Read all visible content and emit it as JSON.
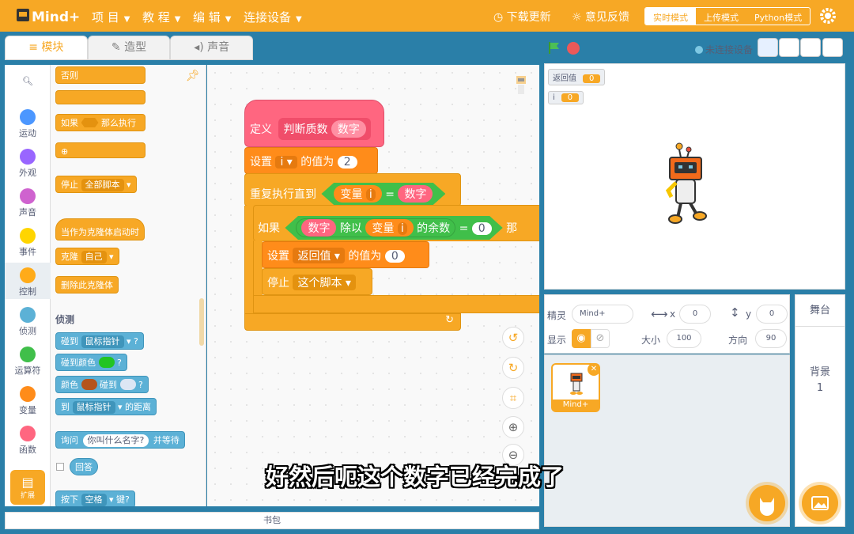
{
  "menu": {
    "items": [
      "项 目",
      "教 程",
      "编 辑",
      "连接设备"
    ],
    "download": "下载更新",
    "feedback": "意见反馈",
    "modes": [
      "实时模式",
      "上传模式",
      "Python模式"
    ]
  },
  "tabs": [
    "模块",
    "造型",
    "声音"
  ],
  "stage": {
    "status": "未连接设备",
    "monitors": [
      {
        "label": "返回值",
        "value": "0"
      },
      {
        "label": "i",
        "value": "0"
      }
    ]
  },
  "categories": [
    {
      "label": "运动",
      "color": "#4c97ff"
    },
    {
      "label": "外观",
      "color": "#9966ff"
    },
    {
      "label": "声音",
      "color": "#cf63cf"
    },
    {
      "label": "事件",
      "color": "#ffd500"
    },
    {
      "label": "控制",
      "color": "#ffab19"
    },
    {
      "label": "侦测",
      "color": "#5cb1d6"
    },
    {
      "label": "运算符",
      "color": "#40bf4a"
    },
    {
      "label": "变量",
      "color": "#ff8c1a"
    },
    {
      "label": "函数",
      "color": "#ff6680"
    }
  ],
  "extension_label": "扩展",
  "palette": {
    "else": "否则",
    "if_label": "如果",
    "then": "那么执行",
    "stop": "停止",
    "stop_opt": "全部脚本",
    "clone_start": "当作为克隆体启动时",
    "clone": "克隆",
    "clone_opt": "自己",
    "delete_clone": "删除此克隆体",
    "sensing_title": "侦测",
    "touch": "碰到",
    "mouse": "鼠标指针",
    "q": "?",
    "touch_color": "碰到颜色",
    "color": "颜色",
    "to": "到",
    "distance": "的距离",
    "ask": "询问",
    "ask_default": "你叫什么名字?",
    "wait": "并等待",
    "answer": "回答",
    "press": "按下",
    "space": "空格",
    "key": "键?"
  },
  "script": {
    "define": "定义",
    "func": "判断质数",
    "param": "数字",
    "set": "设置",
    "var_i": "i",
    "value_to": "的值为",
    "two": "2",
    "repeat_until": "重复执行直到",
    "variable": "变量",
    "eq": "=",
    "if_label": "如果",
    "mod_by": "除以",
    "remainder": "的余数",
    "zero": "0",
    "then_cut": "那",
    "return_var": "返回值",
    "stop": "停止",
    "this_script": "这个脚本"
  },
  "sprite": {
    "label": "精灵",
    "name": "Mind+",
    "x_label": "x",
    "x": "0",
    "y_label": "y",
    "y": "0",
    "show": "显示",
    "size_label": "大小",
    "size": "100",
    "dir_label": "方向",
    "dir": "90",
    "thumb_name": "Mind+"
  },
  "stage_panel": {
    "title": "舞台",
    "backdrop": "背景",
    "count": "1"
  },
  "bottom": "书包",
  "subtitle": "好然后呃这个数字已经完成了"
}
